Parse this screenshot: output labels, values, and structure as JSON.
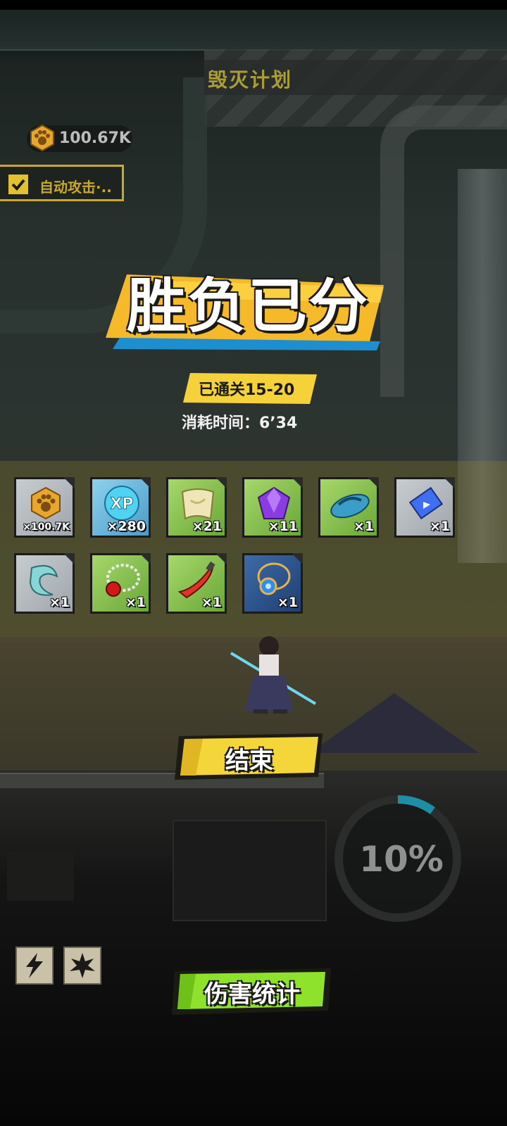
{
  "header": {
    "stage_title": "毁灭计划",
    "currency_amount": "100.67K",
    "auto_attack_label": "自动攻击·.."
  },
  "result": {
    "banner_title": "胜负已分",
    "cleared_label": "已通关15-20",
    "time_label": "消耗时间：6’34"
  },
  "rewards": [
    {
      "icon": "paw-coin-icon",
      "qty": "×100.7K",
      "bg": "gray"
    },
    {
      "icon": "xp-orb-icon",
      "qty": "×280",
      "bg": "blue"
    },
    {
      "icon": "scroll-icon",
      "qty": "×21",
      "bg": "green"
    },
    {
      "icon": "purple-gem-icon",
      "qty": "×11",
      "bg": "green"
    },
    {
      "icon": "slipper-icon",
      "qty": "×1",
      "bg": "green"
    },
    {
      "icon": "ticket-icon",
      "qty": "×1",
      "bg": "gray"
    },
    {
      "icon": "jade-fang-icon",
      "qty": "×1",
      "bg": "gray"
    },
    {
      "icon": "red-bead-necklace-icon",
      "qty": "×1",
      "bg": "green"
    },
    {
      "icon": "red-blade-icon",
      "qty": "×1",
      "bg": "green"
    },
    {
      "icon": "blue-amulet-icon",
      "qty": "×1",
      "bg": "navy"
    }
  ],
  "buttons": {
    "end_label": "结束",
    "damage_stats_label": "伤害统计"
  },
  "progress": {
    "percent_label": "10%",
    "fraction": 0.1
  },
  "skills": [
    {
      "icon": "lightning-skill-icon"
    },
    {
      "icon": "explosion-skill-icon"
    }
  ],
  "colors": {
    "accent_yellow": "#f5d63a",
    "accent_green": "#8fe22b",
    "ring_teal": "#1c8fa6"
  }
}
